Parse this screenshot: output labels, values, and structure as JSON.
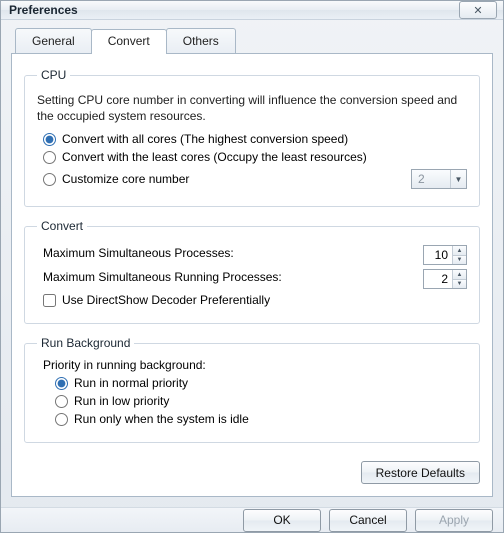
{
  "window": {
    "title": "Preferences"
  },
  "tabs": {
    "general": "General",
    "convert": "Convert",
    "others": "Others",
    "active": "convert"
  },
  "cpu": {
    "legend": "CPU",
    "desc": "Setting CPU core number in converting will influence the conversion speed and the occupied system resources.",
    "opt_all": "Convert with all cores (The highest conversion speed)",
    "opt_least": "Convert with the least cores (Occupy the least resources)",
    "opt_custom": "Customize core number",
    "custom_value": "2",
    "selected": "all"
  },
  "convert": {
    "legend": "Convert",
    "max_proc_label": "Maximum Simultaneous Processes:",
    "max_proc_value": "10",
    "max_run_label": "Maximum Simultaneous Running Processes:",
    "max_run_value": "2",
    "directshow_label": "Use DirectShow Decoder Preferentially",
    "directshow_checked": false
  },
  "runbg": {
    "legend": "Run Background",
    "prompt": "Priority in running background:",
    "opt_normal": "Run in normal priority",
    "opt_low": "Run in low priority",
    "opt_idle": "Run only when the system is idle",
    "selected": "normal"
  },
  "buttons": {
    "restore": "Restore Defaults",
    "ok": "OK",
    "cancel": "Cancel",
    "apply": "Apply"
  }
}
